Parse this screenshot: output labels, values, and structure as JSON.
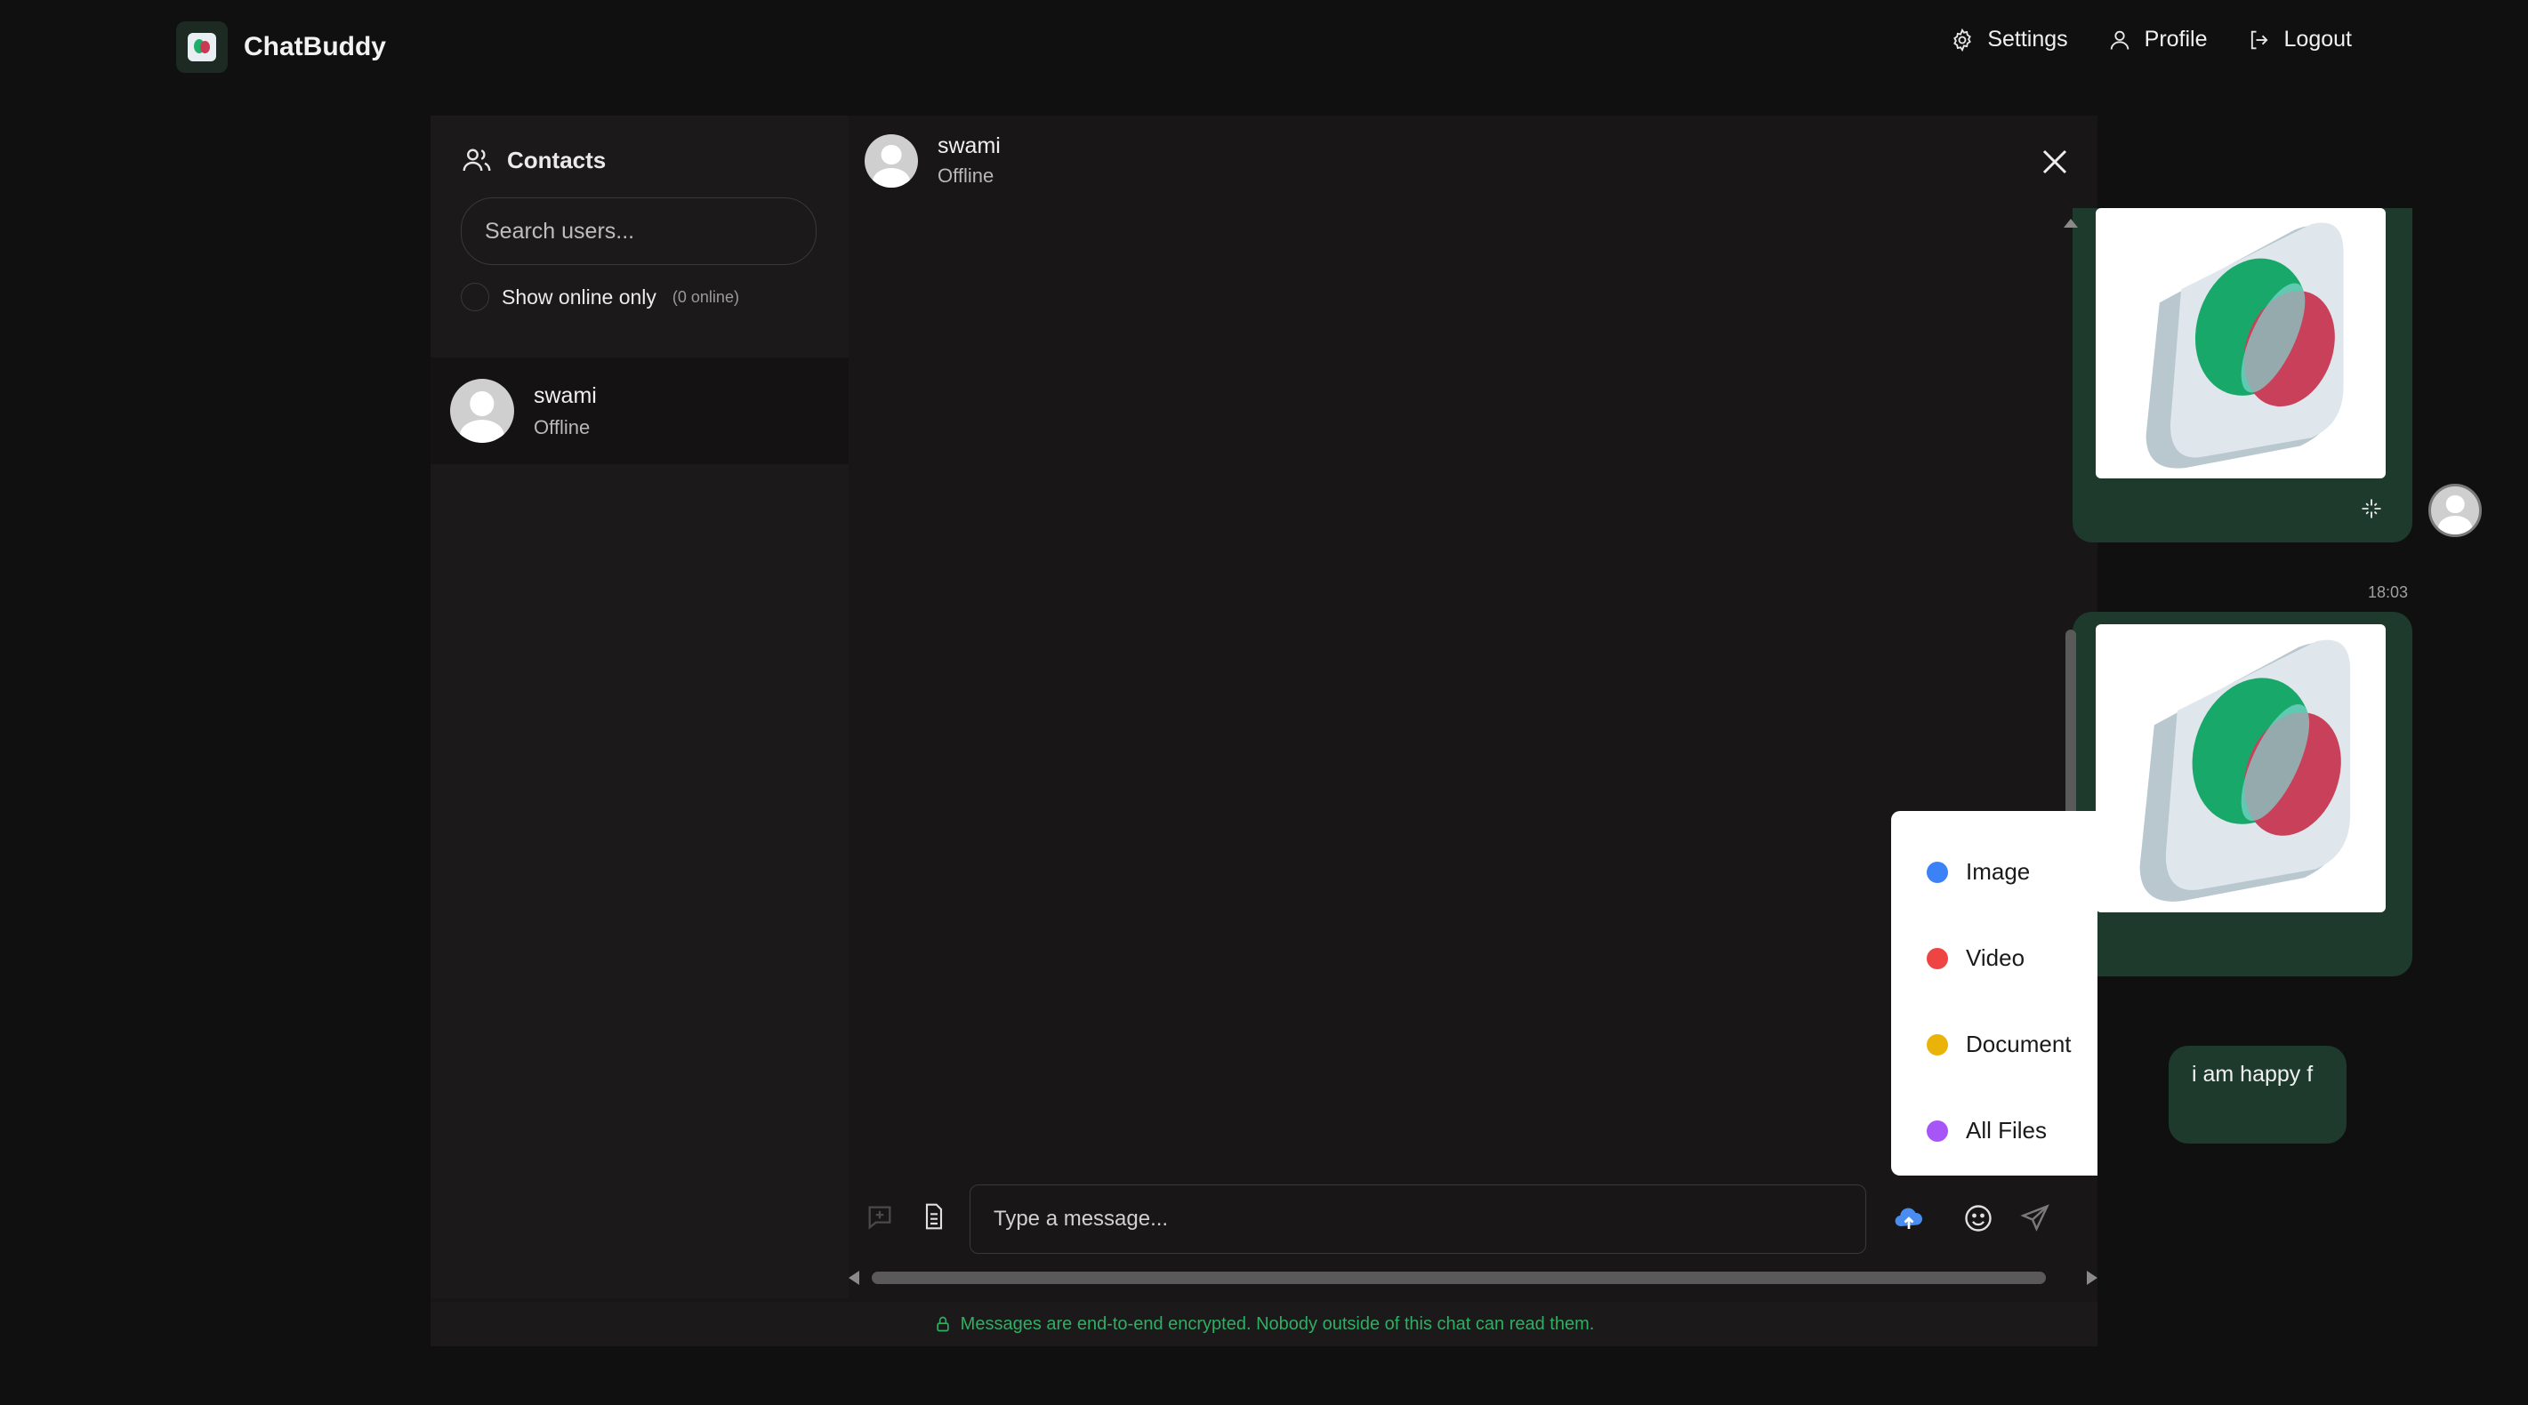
{
  "brand": {
    "name": "ChatBuddy"
  },
  "nav": {
    "settings": "Settings",
    "profile": "Profile",
    "logout": "Logout"
  },
  "sidebar": {
    "title": "Contacts",
    "search_placeholder": "Search users...",
    "online_only_label": "Show online only",
    "online_count": "(0 online)",
    "contacts": [
      {
        "name": "swami",
        "status": "Offline"
      }
    ]
  },
  "chat": {
    "contact_name": "swami",
    "contact_status": "Offline",
    "messages": [
      {
        "type": "image",
        "sender": "me",
        "icon": "chat-bubbles-3d-image"
      },
      {
        "type": "image",
        "sender": "me",
        "time": "18:03",
        "icon": "chat-bubbles-3d-image"
      },
      {
        "type": "text",
        "sender": "me",
        "text": "i am happy f"
      }
    ]
  },
  "attach_menu": {
    "items": [
      {
        "label": "Image",
        "color": "#3b82f6"
      },
      {
        "label": "Video",
        "color": "#ef4444"
      },
      {
        "label": "Document",
        "color": "#eab308"
      },
      {
        "label": "All Files",
        "color": "#a855f7"
      }
    ]
  },
  "composer": {
    "placeholder": "Type a message..."
  },
  "footer": {
    "text": "Messages are end-to-end encrypted. Nobody outside of this chat can read them."
  },
  "colors": {
    "bubble": "#1e3a2c",
    "accent_green": "#2fae64",
    "upload_icon": "#4a8df0"
  }
}
